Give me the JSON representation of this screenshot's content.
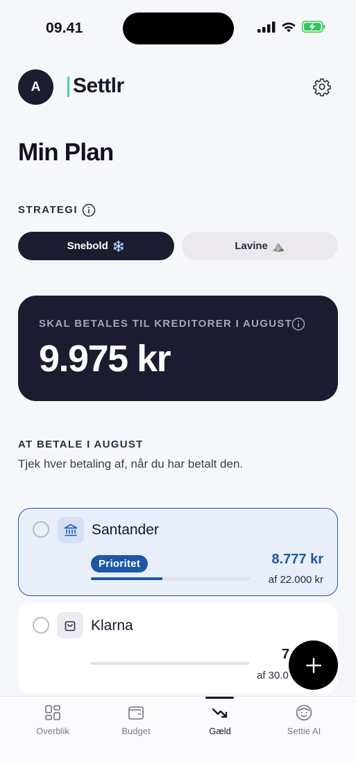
{
  "status_bar": {
    "time": "09.41"
  },
  "header": {
    "avatar_initial": "A",
    "logo_text": "Settlr"
  },
  "page": {
    "title": "Min Plan"
  },
  "strategy": {
    "label": "STRATEGI",
    "options": [
      {
        "label": "Snebold",
        "emoji": "❄️",
        "active": true
      },
      {
        "label": "Lavine",
        "emoji": "⛰️",
        "active": false
      }
    ]
  },
  "summary": {
    "label": "SKAL BETALES TIL KREDITORER I AUGUST",
    "amount": "9.975 kr"
  },
  "payments": {
    "section_label": "AT BETALE I AUGUST",
    "subtitle": "Tjek hver betaling af, når du har betalt den.",
    "items": [
      {
        "name": "Santander",
        "icon": "bank-icon",
        "badge": "Prioritet",
        "amount": "8.777 kr",
        "of_text": "af 22.000 kr",
        "progress": 0.45,
        "highlighted": true,
        "checked": false
      },
      {
        "name": "Klarna",
        "icon": "shopping-bag-icon",
        "amount": "7",
        "of_text": "af 30.0",
        "progress": 0.0,
        "highlighted": false,
        "checked": false
      }
    ]
  },
  "tabs": [
    {
      "label": "Overblik",
      "icon": "grid-icon",
      "active": false
    },
    {
      "label": "Budget",
      "icon": "wallet-icon",
      "active": false
    },
    {
      "label": "Gæld",
      "icon": "trend-down-icon",
      "active": true
    },
    {
      "label": "Settie AI",
      "icon": "assistant-face-icon",
      "active": false
    }
  ],
  "colors": {
    "navy": "#1b1c30",
    "accent_blue": "#1d57a8",
    "logo_accent": "#3fd8a3",
    "battery_green": "#34c759"
  }
}
